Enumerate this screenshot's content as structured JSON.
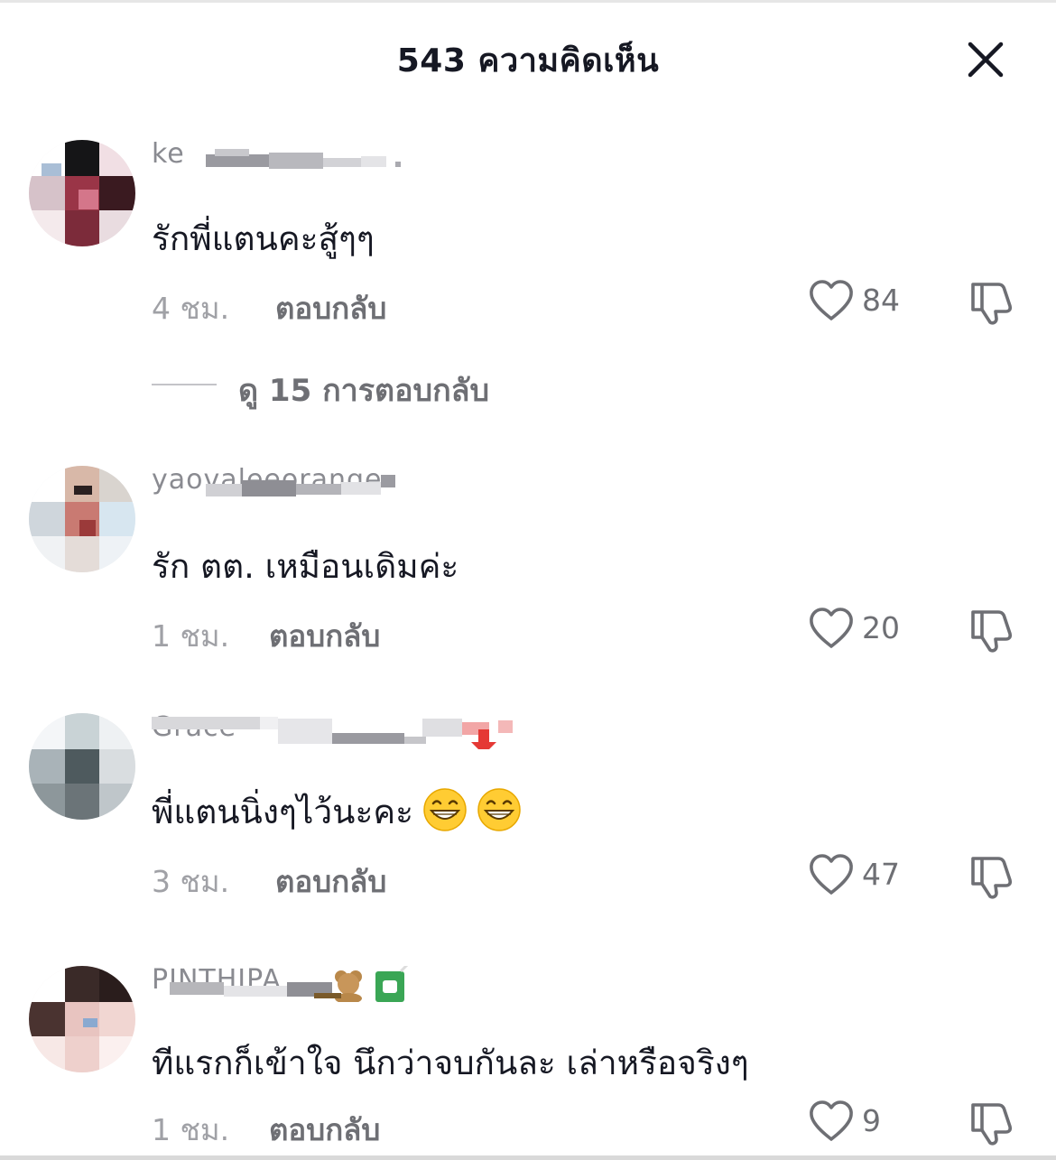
{
  "header": {
    "title": "543 ความคิดเห็น"
  },
  "comments": [
    {
      "username": "ke",
      "text": "รักพี่แตนคะสู้ๆๆ",
      "time": "4 ชม.",
      "reply_label": "ตอบกลับ",
      "likes": "84",
      "view_replies": "ดู 15 การตอบกลับ"
    },
    {
      "username": "yaovaleeorange",
      "text": "รัก ตต. เหมือนเดิมค่ะ",
      "time": "1 ชม.",
      "reply_label": "ตอบกลับ",
      "likes": "20"
    },
    {
      "username": "Grace",
      "text": "พี่แตนนิ่งๆไว้นะคะ",
      "emojis": [
        "grinning-face-icon",
        "grinning-face-icon"
      ],
      "time": "3 ชม.",
      "reply_label": "ตอบกลับ",
      "likes": "47"
    },
    {
      "username": "PINTHIPA",
      "username_icons": [
        "teddy-bear-icon",
        "juice-box-icon"
      ],
      "text": "ทีแรกก็เข้าใจ นึกว่าจบกันละ เล่าหรือจริงๆ",
      "time": "1 ชม.",
      "reply_label": "ตอบกลับ",
      "likes": "9"
    }
  ],
  "colors": {
    "primary_text": "#161823",
    "secondary_text": "#6e6f74",
    "muted_text": "#a0a1a6",
    "icon": "#6e6f74"
  },
  "icons": {
    "close": "close-icon",
    "like": "heart-outline-icon",
    "dislike": "thumbs-down-outline-icon"
  }
}
